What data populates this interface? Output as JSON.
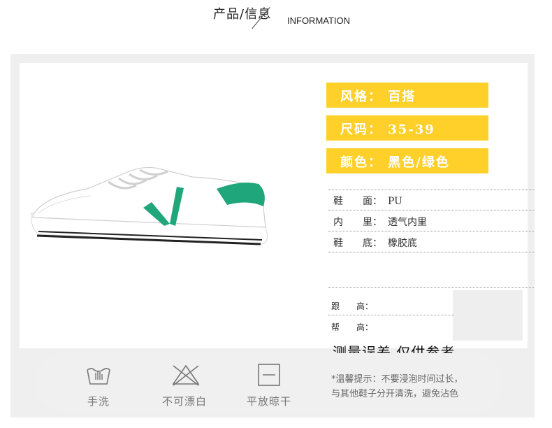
{
  "header": {
    "title_cn": "产品/信息",
    "title_en": "INFORMATION"
  },
  "tags": [
    {
      "text": "风格： 百搭"
    },
    {
      "text": "尺码： 35-39"
    },
    {
      "text": "颜色： 黑色/绿色"
    }
  ],
  "specs": [
    {
      "label": "鞋　　面：",
      "value": "PU"
    },
    {
      "label": "内　　里：",
      "value": "透气内里"
    },
    {
      "label": "鞋　　底：",
      "value": "橡胶底"
    }
  ],
  "measure": [
    {
      "label": "跟　　高："
    },
    {
      "label": "帮　　高："
    }
  ],
  "disclaimer": "测量误差  仅供参考",
  "care": {
    "items": [
      {
        "label": "手洗",
        "icon": "hand-wash-icon"
      },
      {
        "label": "不可漂白",
        "icon": "no-bleach-icon"
      },
      {
        "label": "平放晾干",
        "icon": "dry-flat-icon"
      }
    ],
    "note_line1": "*温馨提示：不要浸泡时间过长，",
    "note_line2": "与其他鞋子分开清洗，避免沾色"
  },
  "colors": {
    "tag": "#ffd02a",
    "accent_green": "#1fa67a",
    "panel": "#efefef"
  }
}
